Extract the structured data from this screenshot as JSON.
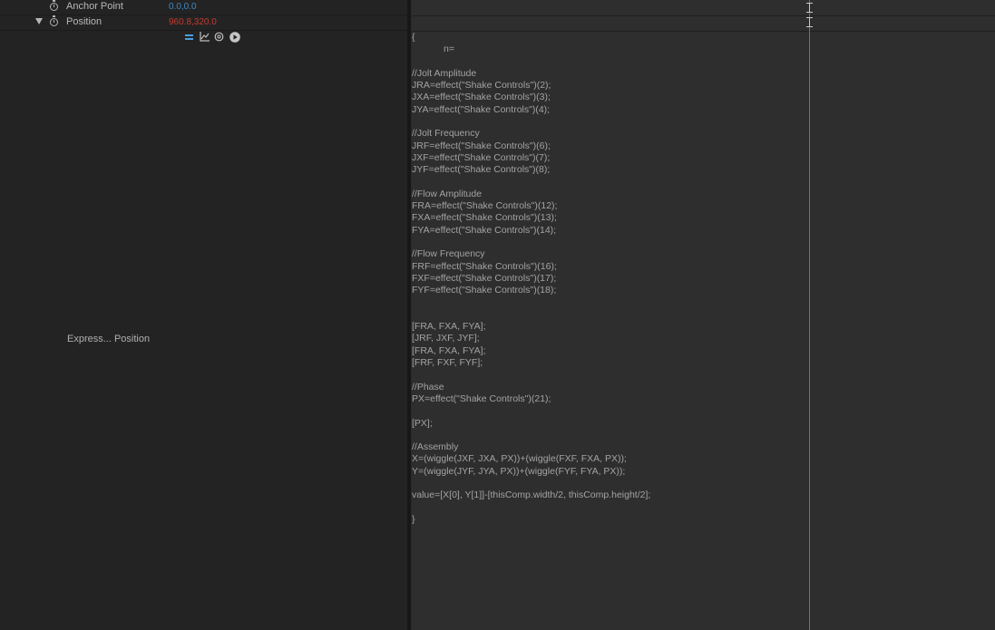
{
  "layers": {
    "anchor_point": {
      "label": "Anchor Point",
      "value": "0.0,0.0"
    },
    "position": {
      "label": "Position",
      "value": "960.8,320.0"
    }
  },
  "expression": {
    "label": "Express... Position",
    "code_lines": [
      "{",
      "            n=",
      "",
      "//Jolt Amplitude",
      "JRA=effect(\"Shake Controls\")(2);",
      "JXA=effect(\"Shake Controls\")(3);",
      "JYA=effect(\"Shake Controls\")(4);",
      "",
      "//Jolt Frequency",
      "JRF=effect(\"Shake Controls\")(6);",
      "JXF=effect(\"Shake Controls\")(7);",
      "JYF=effect(\"Shake Controls\")(8);",
      "",
      "//Flow Amplitude",
      "FRA=effect(\"Shake Controls\")(12);",
      "FXA=effect(\"Shake Controls\")(13);",
      "FYA=effect(\"Shake Controls\")(14);",
      "",
      "//Flow Frequency",
      "FRF=effect(\"Shake Controls\")(16);",
      "FXF=effect(\"Shake Controls\")(17);",
      "FYF=effect(\"Shake Controls\")(18);",
      "",
      "",
      "[FRA, FXA, FYA];",
      "[JRF, JXF, JYF];",
      "[FRA, FXA, FYA];",
      "[FRF, FXF, FYF];",
      "",
      "//Phase",
      "PX=effect(\"Shake Controls\")(21);",
      "",
      "[PX];",
      "",
      "//Assembly",
      "X=(wiggle(JXF, JXA, PX))+(wiggle(FXF, FXA, PX));",
      "Y=(wiggle(JYF, JYA, PX))+(wiggle(FYF, FYA, PX));",
      "",
      "value=[X[0], Y[1]]-[thisComp.width/2, thisComp.height/2];",
      "",
      "}"
    ]
  },
  "icons": {
    "equals": "expression-enable-icon",
    "graph": "graph-editor-icon",
    "pickwhip": "pickwhip-icon",
    "language": "expression-language-menu-icon"
  },
  "colors": {
    "value_blue": "#3d89c4",
    "value_red": "#c33b30",
    "time_indicator": "#3a7fb4"
  }
}
